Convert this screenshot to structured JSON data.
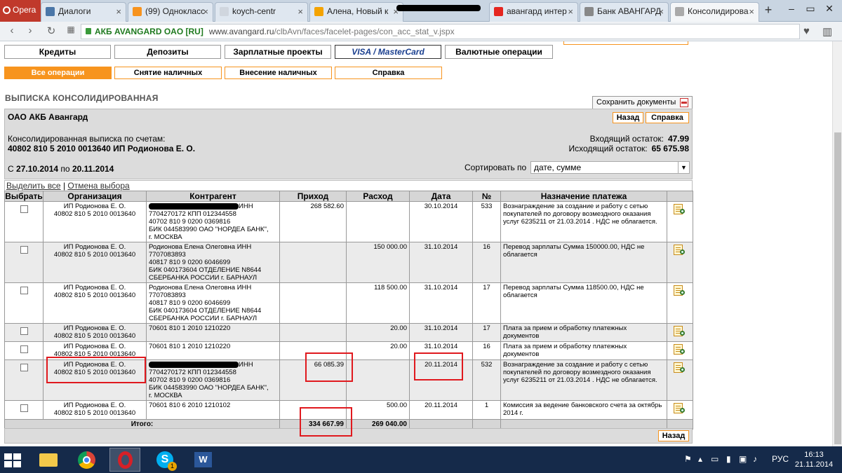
{
  "browser": {
    "menu_label": "Opera",
    "tabs": [
      {
        "title": "Диалоги",
        "color": "#4a76a8"
      },
      {
        "title": "(99) Однокласс",
        "color": "#f7931e"
      },
      {
        "title": "koych-centr",
        "color": "#d0d6de"
      },
      {
        "title": "Алена, Новый к",
        "color": "#f4a300"
      },
      {
        "title": "авангард интер",
        "color": "#e52620"
      },
      {
        "title": "Банк АВАНГАРД",
        "color": "#888888"
      },
      {
        "title": "Консолидирова",
        "color": "#aaaaaa"
      }
    ],
    "new_tab": "+",
    "address": {
      "site_label": "АКБ AVANGARD OAO [RU]",
      "domain": "www.avangard.ru",
      "path": "/clbAvn/faces/facelet-pages/con_acc_stat_v.jspx"
    }
  },
  "nav_main": [
    "Кредиты",
    "Депозиты",
    "Зарплатные проекты",
    "VISA / MasterCard",
    "Валютные операции"
  ],
  "nav_sub": [
    "Все операции",
    "Снятие наличных",
    "Внесение наличных",
    "Справка"
  ],
  "page_title": "ВЫПИСКА КОНСОЛИДИРОВАННАЯ",
  "save_docs_label": "Сохранить документы",
  "bank_name": "ОАО АКБ Авангард",
  "back_label": "Назад",
  "help_label": "Справка",
  "statement_label": "Консолидированная выписка по счетам:",
  "account_line": "40802 810 5 2010 0013640 ИП Родионова Е. О.",
  "opening_balance_label": "Входящий остаток:",
  "opening_balance": "47.99",
  "closing_balance_label": "Исходящий остаток:",
  "closing_balance": "65 675.98",
  "period": {
    "prefix": "С",
    "from": "27.10.2014",
    "mid": "по",
    "to": "20.11.2014"
  },
  "sort": {
    "label": "Сортировать по",
    "value": "дате, сумме"
  },
  "select_all": "Выделить все",
  "separator": "|",
  "deselect": "Отмена выбора",
  "table": {
    "headers": [
      "Выбрать",
      "Организация",
      "Контрагент",
      "Приход",
      "Расход",
      "Дата",
      "№",
      "Назначение платежа"
    ],
    "rows": [
      {
        "org": "ИП Родионова Е. О.\n40802 810 5 2010 0013640",
        "cp_redacted": true,
        "cp_tail": "ИНН",
        "cp_lines": "7704270172 КПП 012344558\n40702 810 9 0200 0369816\nБИК 044583990 ОАО \"НОРДЕА БАНК\",\nг. МОСКВА",
        "income": "268 582.60",
        "expense": "",
        "date": "30.10.2014",
        "num": "533",
        "purpose": "Вознаграждение за создание и работу с сетью покупателей по договору возмездного оказания услуг 6235211 от 21.03.2014 . НДС не облагается.",
        "shade": false
      },
      {
        "org": "ИП Родионова Е. О.\n40802 810 5 2010 0013640",
        "cp_redacted": false,
        "cp_tail": "",
        "cp_lines": "Родионова Елена Олеговна ИНН\n7707083893\n40817 810 9 0200 6046699\nБИК 040173604 ОТДЕЛЕНИЕ N8644\nСБЕРБАНКА РОССИИ г. БАРНАУЛ",
        "income": "",
        "expense": "150 000.00",
        "date": "31.10.2014",
        "num": "16",
        "purpose": "Перевод зарплаты Сумма 150000.00, НДС не облагается",
        "shade": true
      },
      {
        "org": "ИП Родионова Е. О.\n40802 810 5 2010 0013640",
        "cp_redacted": false,
        "cp_tail": "",
        "cp_lines": "Родионова Елена Олеговна ИНН\n7707083893\n40817 810 9 0200 6046699\nБИК 040173604 ОТДЕЛЕНИЕ N8644\nСБЕРБАНКА РОССИИ г. БАРНАУЛ",
        "income": "",
        "expense": "118 500.00",
        "date": "31.10.2014",
        "num": "17",
        "purpose": "Перевод зарплаты Сумма 118500.00, НДС не облагается",
        "shade": false
      },
      {
        "org": "ИП Родионова Е. О.\n40802 810 5 2010 0013640",
        "cp_redacted": false,
        "cp_tail": "",
        "cp_lines": "70601 810 1 2010 1210220",
        "income": "",
        "expense": "20.00",
        "date": "31.10.2014",
        "num": "17",
        "purpose": "Плата за прием и обработку платежных документов",
        "shade": true
      },
      {
        "org": "ИП Родионова Е. О.\n40802 810 5 2010 0013640",
        "cp_redacted": false,
        "cp_tail": "",
        "cp_lines": "70601 810 1 2010 1210220",
        "income": "",
        "expense": "20.00",
        "date": "31.10.2014",
        "num": "16",
        "purpose": "Плата за прием и обработку платежных документов",
        "shade": false
      },
      {
        "org": "ИП Родионова Е. О.\n40802 810 5 2010 0013640",
        "cp_redacted": true,
        "cp_tail": "ИНН",
        "cp_lines": "7704270172 КПП 012344558\n40702 810 9 0200 0369816\nБИК 044583990 ОАО \"НОРДЕА БАНК\",\nг. МОСКВА",
        "income": "66 085.39",
        "expense": "",
        "date": "20.11.2014",
        "num": "532",
        "purpose": "Вознаграждение за создание и работу с сетью покупателей по договору возмездного оказания услуг 6235211 от 21.03.2014 . НДС не облагается.",
        "shade": true
      },
      {
        "org": "ИП Родионова Е. О.\n40802 810 5 2010 0013640",
        "cp_redacted": false,
        "cp_tail": "",
        "cp_lines": "70601 810 6 2010 1210102",
        "income": "",
        "expense": "500.00",
        "date": "20.11.2014",
        "num": "1",
        "purpose": "Комиссия за ведение банковского счета за октябрь 2014 г.",
        "shade": false
      }
    ],
    "total_label": "Итого:",
    "total_income": "334 667.99",
    "total_expense": "269 040.00"
  },
  "taskbar": {
    "lang": "РУС",
    "time": "16:13",
    "date": "21.11.2014",
    "apps": [
      "file-explorer",
      "chrome",
      "opera",
      "skype",
      "word"
    ],
    "skype_badge": "1"
  }
}
